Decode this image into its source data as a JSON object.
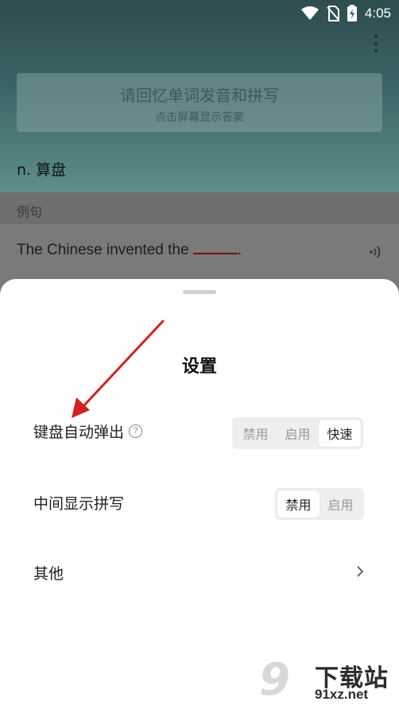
{
  "status_bar": {
    "time": "4:05"
  },
  "background": {
    "prompt_title": "请回忆单词发音和拼写",
    "prompt_subtitle": "点击屏幕显示答案",
    "word": "n. 算盘",
    "section_label": "例句",
    "sentence_prefix": "The Chinese invented the",
    "sentence_suffix": "."
  },
  "settings": {
    "title": "设置",
    "rows": [
      {
        "label": "键盘自动弹出",
        "options": [
          "禁用",
          "启用",
          "快速"
        ],
        "selected": "快速"
      },
      {
        "label": "中间显示拼写",
        "options": [
          "禁用",
          "启用"
        ],
        "selected": "禁用"
      },
      {
        "label": "其他"
      }
    ]
  },
  "watermark": {
    "text": "下载站",
    "url": "91xz.net",
    "logo": "9"
  },
  "colors": {
    "annotation_arrow": "#d42020",
    "header_teal": "#3b6466",
    "sheet": "#ffffff"
  },
  "icons": [
    "wifi-icon",
    "no-sim-icon",
    "battery-charging-icon",
    "more-vert-icon",
    "speaker-icon",
    "help-icon",
    "chevron-right-icon"
  ]
}
